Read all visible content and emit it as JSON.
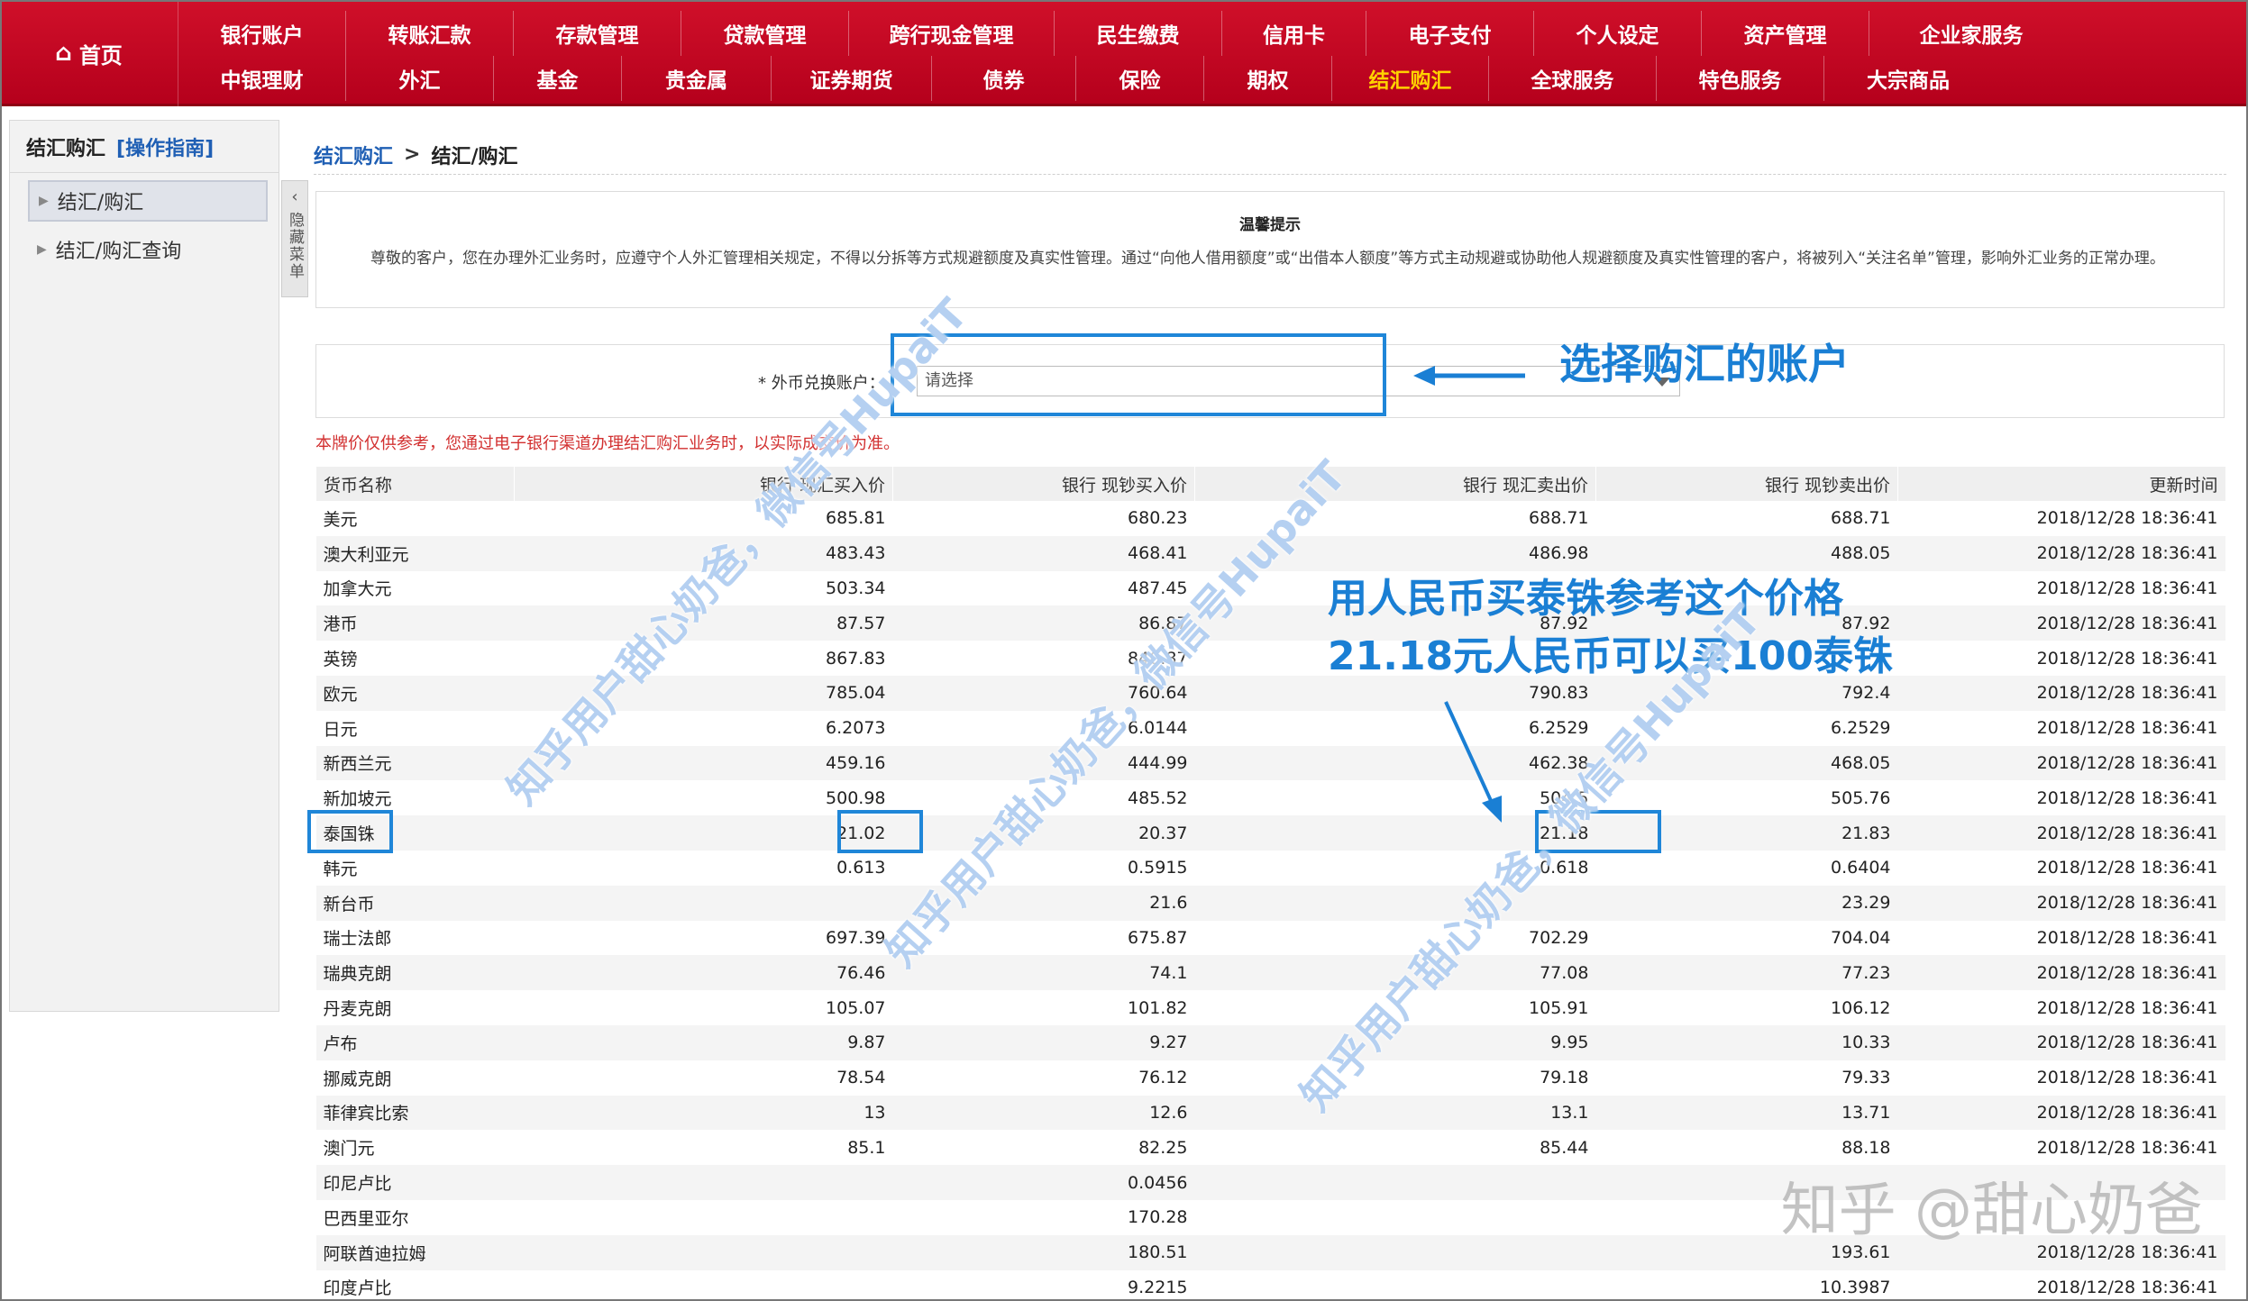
{
  "nav": {
    "home_label": "首页",
    "row1": [
      "银行账户",
      "转账汇款",
      "存款管理",
      "贷款管理",
      "跨行现金管理",
      "民生缴费",
      "信用卡",
      "电子支付",
      "个人设定",
      "资产管理",
      "企业家服务"
    ],
    "row2": [
      "中银理财",
      "外汇",
      "基金",
      "贵金属",
      "证券期货",
      "债券",
      "保险",
      "期权",
      "结汇购汇",
      "全球服务",
      "特色服务",
      "大宗商品"
    ],
    "active_label": "结汇购汇"
  },
  "sidebar": {
    "title": "结汇购汇",
    "guide_link": "[操作指南]",
    "items": [
      "结汇/购汇",
      "结汇/购汇查询"
    ],
    "hide_toggle": "隐藏菜单"
  },
  "breadcrumb": {
    "root": "结汇购汇",
    "sep": ">",
    "current": "结汇/购汇"
  },
  "notice": {
    "title": "温馨提示",
    "text": "尊敬的客户，您在办理外汇业务时，应遵守个人外汇管理相关规定，不得以分拆等方式规避额度及真实性管理。通过“向他人借用额度”或“出借本人额度”等方式主动规避或协助他人规避额度及真实性管理的客户，将被列入“关注名单”管理，影响外汇业务的正常办理。"
  },
  "account": {
    "label": "* 外币兑换账户：",
    "placeholder": "请选择"
  },
  "disclaimer": "本牌价仅供参考，您通过电子银行渠道办理结汇购汇业务时，以实际成交价为准。",
  "table": {
    "headers": [
      "货币名称",
      "银行 现汇买入价",
      "银行 现钞买入价",
      "银行 现汇卖出价",
      "银行 现钞卖出价",
      "更新时间"
    ],
    "rows": [
      [
        "美元",
        "685.81",
        "680.23",
        "688.71",
        "688.71",
        "2018/12/28 18:36:41"
      ],
      [
        "澳大利亚元",
        "483.43",
        "468.41",
        "486.98",
        "488.05",
        "2018/12/28 18:36:41"
      ],
      [
        "加拿大元",
        "503.34",
        "487.45",
        "",
        "",
        "2018/12/28 18:36:41"
      ],
      [
        "港币",
        "87.57",
        "86.87",
        "87.92",
        "87.92",
        "2018/12/28 18:36:41"
      ],
      [
        "英镑",
        "867.83",
        "840.87",
        "",
        "",
        "2018/12/28 18:36:41"
      ],
      [
        "欧元",
        "785.04",
        "760.64",
        "790.83",
        "792.4",
        "2018/12/28 18:36:41"
      ],
      [
        "日元",
        "6.2073",
        "6.0144",
        "6.2529",
        "6.2529",
        "2018/12/28 18:36:41"
      ],
      [
        "新西兰元",
        "459.16",
        "444.99",
        "462.38",
        "468.05",
        "2018/12/28 18:36:41"
      ],
      [
        "新加坡元",
        "500.98",
        "485.52",
        "504.5",
        "505.76",
        "2018/12/28 18:36:41"
      ],
      [
        "泰国铢",
        "21.02",
        "20.37",
        "21.18",
        "21.83",
        "2018/12/28 18:36:41"
      ],
      [
        "韩元",
        "0.613",
        "0.5915",
        "0.618",
        "0.6404",
        "2018/12/28 18:36:41"
      ],
      [
        "新台币",
        "",
        "21.6",
        "",
        "23.29",
        "2018/12/28 18:36:41"
      ],
      [
        "瑞士法郎",
        "697.39",
        "675.87",
        "702.29",
        "704.04",
        "2018/12/28 18:36:41"
      ],
      [
        "瑞典克朗",
        "76.46",
        "74.1",
        "77.08",
        "77.23",
        "2018/12/28 18:36:41"
      ],
      [
        "丹麦克朗",
        "105.07",
        "101.82",
        "105.91",
        "106.12",
        "2018/12/28 18:36:41"
      ],
      [
        "卢布",
        "9.87",
        "9.27",
        "9.95",
        "10.33",
        "2018/12/28 18:36:41"
      ],
      [
        "挪威克朗",
        "78.54",
        "76.12",
        "79.18",
        "79.33",
        "2018/12/28 18:36:41"
      ],
      [
        "菲律宾比索",
        "13",
        "12.6",
        "13.1",
        "13.71",
        "2018/12/28 18:36:41"
      ],
      [
        "澳门元",
        "85.1",
        "82.25",
        "85.44",
        "88.18",
        "2018/12/28 18:36:41"
      ],
      [
        "印尼卢比",
        "",
        "0.0456",
        "",
        "",
        ""
      ],
      [
        "巴西里亚尔",
        "",
        "170.28",
        "",
        "",
        ""
      ],
      [
        "阿联酋迪拉姆",
        "",
        "180.51",
        "",
        "193.61",
        "2018/12/28 18:36:41"
      ],
      [
        "印度卢比",
        "",
        "9.2215",
        "",
        "10.3987",
        "2018/12/28 18:36:41"
      ]
    ]
  },
  "annotations": {
    "select_account": "选择购汇的账户",
    "buy_line1": "用人民币买泰铢参考这个价格",
    "buy_line2": "21.18元人民币可以买100泰铢",
    "watermark": "知乎用户甜心奶爸，微信号HupaiT",
    "brand": "知乎 @甜心奶爸",
    "color": "#1a7fd4"
  }
}
